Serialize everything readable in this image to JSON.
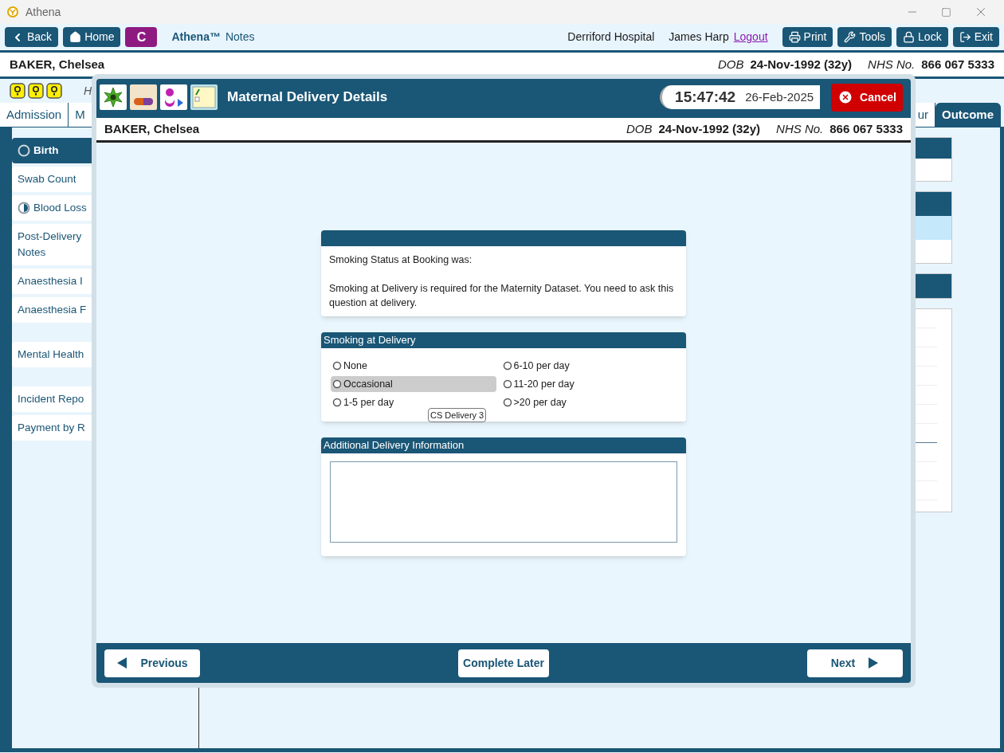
{
  "window": {
    "title": "Athena"
  },
  "toolbar": {
    "back": "Back",
    "home": "Home",
    "badge": "C",
    "app_name": "Athena™",
    "app_suffix": "Notes",
    "hospital": "Derriford Hospital",
    "user": "James Harp",
    "logout": "Logout",
    "buttons": [
      {
        "kind": "print",
        "label": "Print"
      },
      {
        "kind": "tools",
        "label": "Tools"
      },
      {
        "kind": "lock",
        "label": "Lock"
      },
      {
        "kind": "exit",
        "label": "Exit"
      }
    ]
  },
  "patient": {
    "name": "BAKER, Chelsea",
    "dob_label": "DOB",
    "dob": "24-Nov-1992 (32y)",
    "nhs_label": "NHS No.",
    "nhs": "866 067 5333"
  },
  "header_text": "H",
  "tabs": [
    {
      "label": "Admission",
      "selected": false
    },
    {
      "label": "M",
      "selected": false
    },
    {
      "label": "ur",
      "selected": false
    },
    {
      "label": "Outcome",
      "selected": true
    }
  ],
  "sidebar": [
    {
      "items": [
        {
          "label": "Birth",
          "selected": true,
          "kind": "empty"
        },
        {
          "label": "Swab Count",
          "selected": false,
          "kind": "plain"
        },
        {
          "label": "Blood Loss",
          "selected": false,
          "kind": "half"
        },
        {
          "label": "Post-Delivery Notes",
          "selected": false,
          "kind": "plain"
        },
        {
          "label": "Anaesthesia I",
          "selected": false,
          "kind": "plain"
        },
        {
          "label": "Anaesthesia F",
          "selected": false,
          "kind": "plain"
        }
      ]
    },
    {
      "items": [
        {
          "label": "Mental Health",
          "selected": false,
          "kind": "plain"
        }
      ]
    },
    {
      "items": [
        {
          "label": "Incident Repo",
          "selected": false,
          "kind": "plain"
        },
        {
          "label": "Payment by R",
          "selected": false,
          "kind": "plain"
        }
      ]
    }
  ],
  "modal": {
    "title": "Maternal Delivery Details",
    "time": "15:47:42",
    "date": "26-Feb-2025",
    "cancel": "Cancel",
    "patient": {
      "name": "BAKER, Chelsea",
      "dob_label": "DOB",
      "dob": "24-Nov-1992 (32y)",
      "nhs_label": "NHS No.",
      "nhs": "866 067 5333"
    },
    "info": [
      "Smoking Status at Booking was:",
      "Smoking at Delivery is required for the Maternity Dataset. You need to ask this question at delivery."
    ],
    "smoking": {
      "title": "Smoking at Delivery",
      "options": [
        {
          "label": "None",
          "selected": false,
          "hovered": false
        },
        {
          "label": "Occasional",
          "selected": false,
          "hovered": true
        },
        {
          "label": "1-5 per day",
          "selected": false,
          "hovered": false
        },
        {
          "label": "6-10 per day",
          "selected": false,
          "hovered": false
        },
        {
          "label": "11-20 per day",
          "selected": false,
          "hovered": false
        },
        {
          "label": ">20 per day",
          "selected": false,
          "hovered": false
        }
      ]
    },
    "tooltip": "CS Delivery 3",
    "additional": {
      "title": "Additional Delivery Information"
    },
    "footer": {
      "previous": "Previous",
      "complete_later": "Complete Later",
      "next": "Next"
    }
  }
}
